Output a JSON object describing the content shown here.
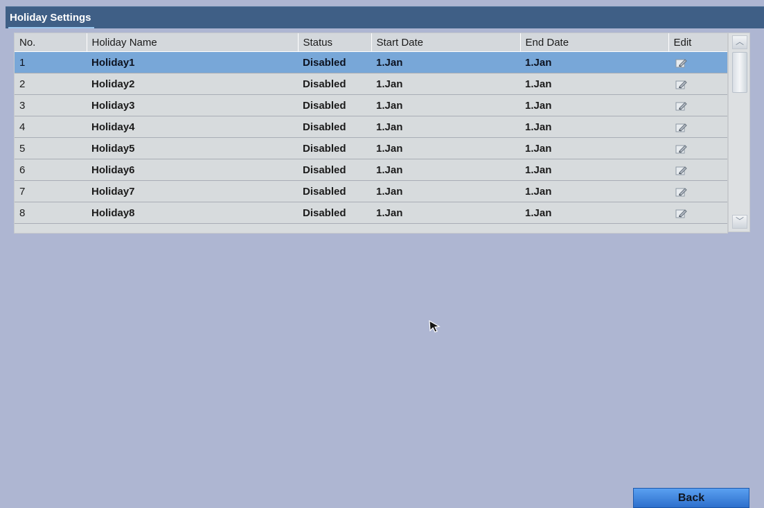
{
  "header": {
    "title": "Holiday Settings"
  },
  "table": {
    "columns": {
      "no": "No.",
      "name": "Holiday Name",
      "status": "Status",
      "start": "Start Date",
      "end": "End Date",
      "edit": "Edit"
    },
    "rows": [
      {
        "no": "1",
        "name": "Holiday1",
        "status": "Disabled",
        "start": "1.Jan",
        "end": "1.Jan",
        "selected": true
      },
      {
        "no": "2",
        "name": "Holiday2",
        "status": "Disabled",
        "start": "1.Jan",
        "end": "1.Jan"
      },
      {
        "no": "3",
        "name": "Holiday3",
        "status": "Disabled",
        "start": "1.Jan",
        "end": "1.Jan"
      },
      {
        "no": "4",
        "name": "Holiday4",
        "status": "Disabled",
        "start": "1.Jan",
        "end": "1.Jan"
      },
      {
        "no": "5",
        "name": "Holiday5",
        "status": "Disabled",
        "start": "1.Jan",
        "end": "1.Jan"
      },
      {
        "no": "6",
        "name": "Holiday6",
        "status": "Disabled",
        "start": "1.Jan",
        "end": "1.Jan"
      },
      {
        "no": "7",
        "name": "Holiday7",
        "status": "Disabled",
        "start": "1.Jan",
        "end": "1.Jan"
      },
      {
        "no": "8",
        "name": "Holiday8",
        "status": "Disabled",
        "start": "1.Jan",
        "end": "1.Jan"
      }
    ]
  },
  "icons": {
    "edit": "edit-pencil-icon",
    "scroll_up": "chevron-up-icon",
    "scroll_down": "chevron-down-icon",
    "cursor": "mouse-cursor-icon"
  },
  "buttons": {
    "back": "Back"
  },
  "colors": {
    "background": "#aeb6d2",
    "title_bar": "#3f5f86",
    "selected_row": "#78a7d8",
    "table_row": "#d7dbdd",
    "button": "#2d6fcc"
  }
}
